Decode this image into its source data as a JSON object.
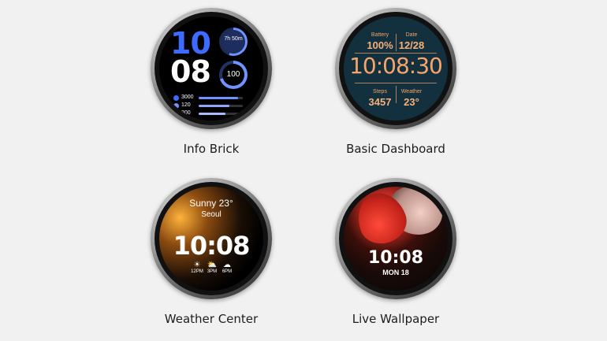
{
  "watch_faces": [
    {
      "label": "Info Brick",
      "hour": "10",
      "minute": "08",
      "sleep": "7h 50m",
      "ring_value": "100",
      "stats": [
        "3000",
        "120",
        "300"
      ]
    },
    {
      "label": "Basic Dashboard",
      "battery_label": "Battery",
      "battery_value": "100%",
      "date_label": "Date",
      "date_value": "12/28",
      "time": "10:08:30",
      "steps_label": "Steps",
      "steps_value": "3457",
      "weather_label": "Weather",
      "weather_value": "23°"
    },
    {
      "label": "Weather Center",
      "condition": "Sunny 23°",
      "city": "Seoul",
      "time": "10:08",
      "forecast": [
        {
          "icon": "☀",
          "time": "12PM"
        },
        {
          "icon": "⛅",
          "time": "3PM"
        },
        {
          "icon": "☁",
          "time": "6PM"
        }
      ]
    },
    {
      "label": "Live Wallpaper",
      "time": "10:08",
      "date": "MON 18"
    }
  ],
  "colors": {
    "info_blue": "#3d6bff",
    "dashboard_orange": "#f7a46a",
    "dashboard_bg": "#13303f"
  }
}
